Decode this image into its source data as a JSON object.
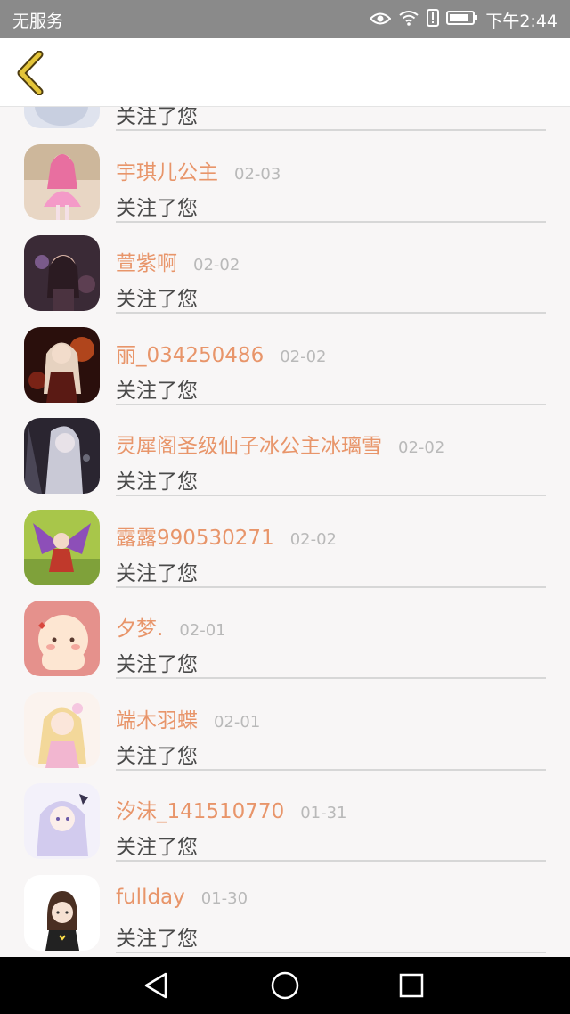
{
  "status_bar": {
    "carrier": "无服务",
    "time": "下午2:44",
    "icons": [
      "eye-icon",
      "wifi-icon",
      "alert-icon",
      "battery-icon"
    ]
  },
  "header": {
    "back_icon": "chevron-left-icon",
    "accent_color": "#e4b93a"
  },
  "items": [
    {
      "name": "",
      "date": "",
      "message": "关注了您"
    },
    {
      "name": "宇琪儿公主",
      "date": "02-03",
      "message": "关注了您"
    },
    {
      "name": "萱紫啊",
      "date": "02-02",
      "message": "关注了您"
    },
    {
      "name": "丽_034250486",
      "date": "02-02",
      "message": "关注了您"
    },
    {
      "name": "灵犀阁圣级仙子冰公主冰璃雪",
      "date": "02-02",
      "message": "关注了您"
    },
    {
      "name": "露露990530271",
      "date": "02-02",
      "message": "关注了您"
    },
    {
      "name": "夕梦.",
      "date": "02-01",
      "message": "关注了您"
    },
    {
      "name": "端木羽蝶",
      "date": "02-01",
      "message": "关注了您"
    },
    {
      "name": "汐沫_141510770",
      "date": "01-31",
      "message": "关注了您"
    },
    {
      "name": "fullday",
      "date": "01-30",
      "message": "关注了您"
    }
  ],
  "colors": {
    "name_color": "#e8956a",
    "date_color": "#b9b9b9",
    "message_color": "#4a4a4a"
  },
  "nav_bar": {
    "icons": [
      "back-triangle-icon",
      "home-circle-icon",
      "recents-square-icon"
    ]
  }
}
